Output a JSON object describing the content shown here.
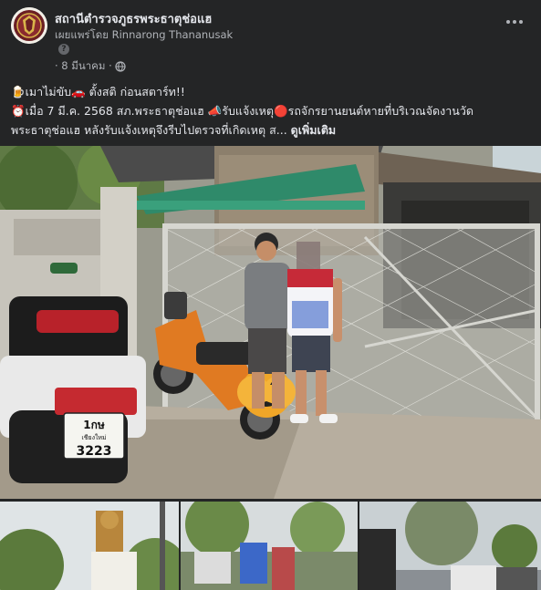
{
  "page": {
    "name": "สถานีตำรวจภูธรพระธาตุช่อแฮ",
    "byline": "เผยแพร่โดย Rinnarong Thananusak",
    "date": "· 8 มีนาคม ·"
  },
  "post": {
    "line1": "🍺เมาไม่ขับ🚗 ตั้งสติ ก่อนสตาร์ท!!",
    "line2": "⏰เมื่อ 7 มี.ค. 2568 สภ.พระธาตุช่อแฮ 📣รับแจ้งเหตุ🔴รถจักรยานยนต์หายที่บริเวณจัดงานวัด",
    "line3_prefix": "พระธาตุช่อแฮ หลังรับแจ้งเหตุจึงรีบไปตรวจที่เกิดเหตุ ส...",
    "see_more": "ดูเพิ่มเติม"
  },
  "photo": {
    "plate_top": "1กษ",
    "plate_province": "เชียงใหม่",
    "plate_number": "3223"
  },
  "icons": {
    "help": "help-icon",
    "globe": "globe-icon",
    "more": "more-options-icon"
  },
  "colors": {
    "background": "#242526",
    "primary_text": "#e4e6eb",
    "secondary_text": "#b0b3b8"
  }
}
